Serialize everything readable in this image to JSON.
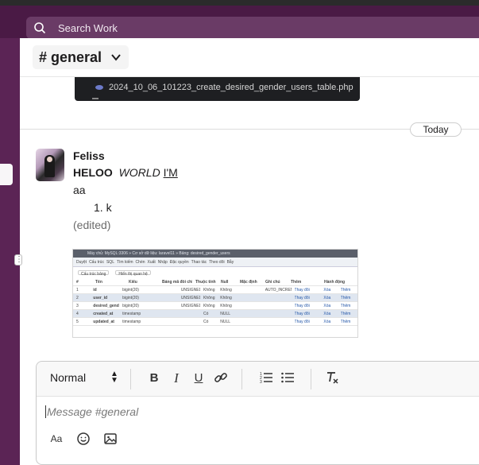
{
  "search": {
    "placeholder": "Search Work",
    "icon": "search-icon"
  },
  "channel": {
    "name": "# general"
  },
  "snippet": {
    "filename": "2024_10_06_101223_create_desired_gender_users_table.php"
  },
  "timeline": {
    "divider_label": "Today"
  },
  "message": {
    "author": "Feliss",
    "bold_text": "HELOO",
    "italic_text": "WORLD",
    "underline_text": "I'M",
    "line2": "aa",
    "list_item": "1. k",
    "edited": "(edited)"
  },
  "attachment": {
    "top_bar": "Máy chủ: MySQL:3306 » Cơ sở dữ liệu: laravel11 » Bảng: desired_gender_users",
    "tabs": [
      "Duyệt",
      "Cấu trúc",
      "SQL",
      "Tìm kiếm",
      "Chèn",
      "Xuất",
      "Nhập",
      "Đặc quyền",
      "Thao tác",
      "Theo dõi",
      "Bẫy"
    ],
    "buttons": [
      "Cấu trúc bảng",
      "Hiển thị quan hệ"
    ],
    "header": [
      "#",
      "Tên",
      "Kiểu",
      "Bảng mã đối chiếu",
      "Thuộc tính",
      "Null",
      "Mặc định",
      "Ghi chú",
      "Thêm",
      "Hành động"
    ],
    "rows": [
      [
        "1",
        "id",
        "bigint(20)",
        "",
        "UNSIGNED",
        "Không",
        "Không",
        "",
        "AUTO_INCREMENT",
        "Thay đổi",
        "Xóa",
        "Thêm"
      ],
      [
        "2",
        "user_id",
        "bigint(20)",
        "",
        "UNSIGNED",
        "Không",
        "Không",
        "",
        "",
        "Thay đổi",
        "Xóa",
        "Thêm"
      ],
      [
        "3",
        "desired_gender_id",
        "bigint(20)",
        "",
        "UNSIGNED",
        "Không",
        "Không",
        "",
        "",
        "Thay đổi",
        "Xóa",
        "Thêm"
      ],
      [
        "4",
        "created_at",
        "timestamp",
        "",
        "",
        "Có",
        "NULL",
        "",
        "",
        "Thay đổi",
        "Xóa",
        "Thêm"
      ],
      [
        "5",
        "updated_at",
        "timestamp",
        "",
        "",
        "Có",
        "NULL",
        "",
        "",
        "Thay đổi",
        "Xóa",
        "Thêm"
      ]
    ]
  },
  "composer": {
    "format": "Normal",
    "placeholder": "Message #general",
    "toolbar_icons": [
      "bold-icon",
      "italic-icon",
      "underline-icon",
      "link-icon",
      "ordered-list-icon",
      "bullet-list-icon",
      "clear-format-icon"
    ],
    "bottom_icons": [
      "text-format-icon",
      "emoji-icon",
      "image-icon"
    ],
    "labels": {
      "bold": "B",
      "italic": "I",
      "underline": "U",
      "text_format": "Aa"
    }
  },
  "colors": {
    "topbar": "#4a1a45",
    "sidebar": "#5b2455",
    "search": "#6a3b66"
  }
}
